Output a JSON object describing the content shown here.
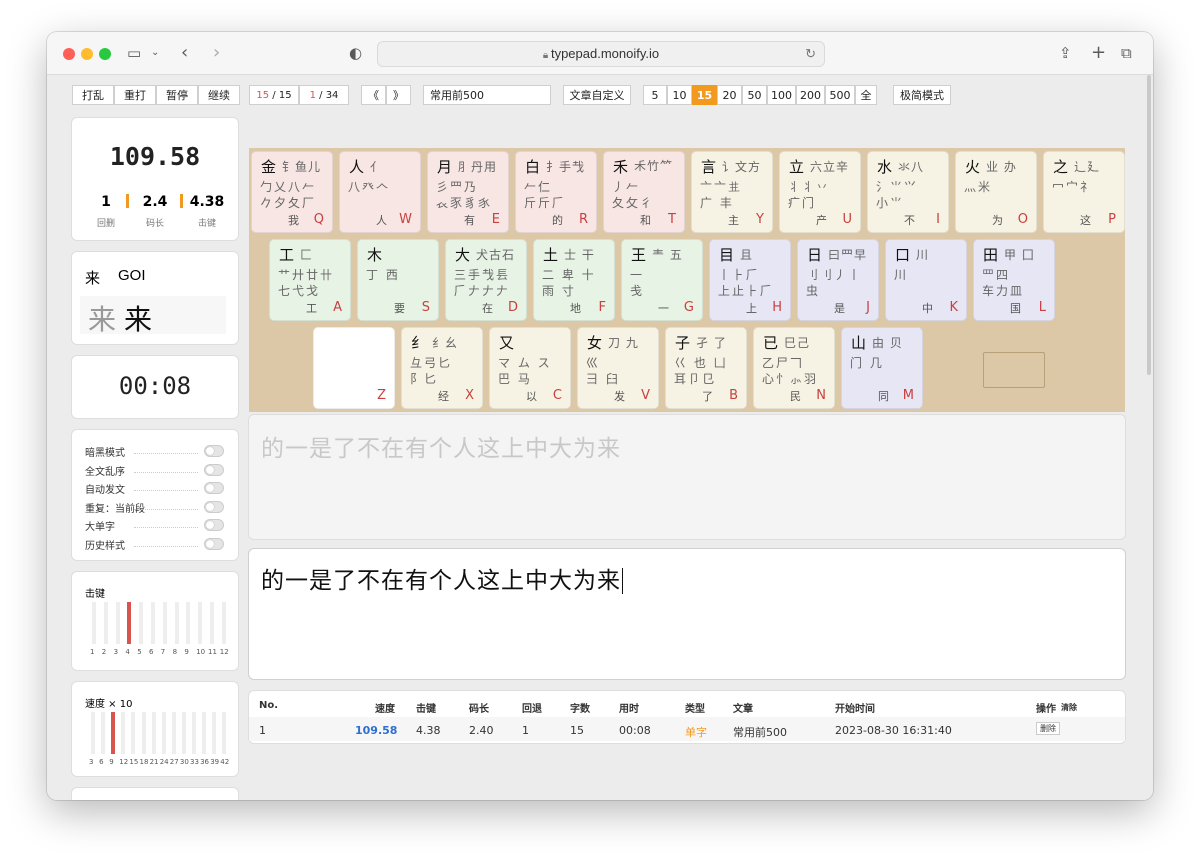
{
  "browser": {
    "url": "typepad.monoify.io"
  },
  "toolbar": {
    "shuffle": "打乱",
    "retype": "重打",
    "pause": "暂停",
    "resume": "继续",
    "para_current": "15",
    "para_total": "15",
    "page_current": "1",
    "page_total": "34",
    "prev": "《",
    "next": "》",
    "article": "常用前500",
    "custom": "文章自定义",
    "counts": [
      "5",
      "10",
      "15",
      "20",
      "50",
      "100",
      "200",
      "500",
      "全"
    ],
    "active_count": "15",
    "mode": "极简模式"
  },
  "stats": {
    "speed": "109.58",
    "backspace": "1",
    "code_len": "2.4",
    "keystroke": "4.38",
    "backspace_label": "回删",
    "code_len_label": "码长",
    "keystroke_label": "击键"
  },
  "hint": {
    "char": "来",
    "code": "GOI",
    "glyph1": "来",
    "glyph2": "来"
  },
  "timer": "00:08",
  "options": [
    "暗黑模式",
    "全文乱序",
    "自动发文",
    "重复：当前段",
    "大单字",
    "历史样式"
  ],
  "keystroke_chart": {
    "title": "击键",
    "labels": [
      "1",
      "2",
      "3",
      "4",
      "5",
      "6",
      "7",
      "8",
      "9",
      "10",
      "11",
      "12"
    ],
    "highlight": 3
  },
  "speed_chart": {
    "title": "速度 × 10",
    "labels": [
      "3",
      "6",
      "9",
      "12",
      "15",
      "18",
      "21",
      "24",
      "27",
      "30",
      "33",
      "36",
      "39",
      "42"
    ],
    "highlight": 2
  },
  "keyboard": {
    "row1": [
      {
        "main": "金",
        "rest": "钅鱼儿",
        "l2": "勹乂八𠂉",
        "l3": "𠂊夕夂厂",
        "ch": "我",
        "key": "Q",
        "bg": "#f7e6e4"
      },
      {
        "main": "人",
        "rest": "亻",
        "l2": "八癶𠆢",
        "l3": "",
        "ch": "人",
        "key": "W",
        "bg": "#f7e6e4"
      },
      {
        "main": "月",
        "rest": "⺼丹用",
        "l2": "彡⺫乃",
        "l3": "𧘇豕豸𧰨",
        "ch": "有",
        "key": "E",
        "bg": "#f7e6e4"
      },
      {
        "main": "白",
        "rest": "扌手𢦏",
        "l2": "𠂉仁",
        "l3": "斤斤𠂆",
        "ch": "的",
        "key": "R",
        "bg": "#f7e6e4"
      },
      {
        "main": "禾",
        "rest": "𥝌竹⺮",
        "l2": "丿𠂉",
        "l3": "夂攵彳",
        "ch": "和",
        "key": "T",
        "bg": "#f7e6e4"
      },
      {
        "main": "言",
        "rest": "讠文方",
        "l2": "亠亠𠀎",
        "l3": "广 丰",
        "ch": "主",
        "key": "Y",
        "bg": "#f6f3e4"
      },
      {
        "main": "立",
        "rest": "六立辛",
        "l2": "丬丬丷",
        "l3": "疒门",
        "ch": "产",
        "key": "U",
        "bg": "#f6f3e4"
      },
      {
        "main": "水",
        "rest": "氺八",
        "l2": "氵⺌⺍",
        "l3": "小⺌",
        "ch": "不",
        "key": "I",
        "bg": "#f6f3e4"
      },
      {
        "main": "火",
        "rest": "业 办",
        "l2": "灬米",
        "l3": "",
        "ch": "为",
        "key": "O",
        "bg": "#f6f3e4"
      },
      {
        "main": "之",
        "rest": "辶廴",
        "l2": "冖宀礻",
        "l3": "",
        "ch": "这",
        "key": "P",
        "bg": "#f6f3e4"
      }
    ],
    "row2": [
      {
        "main": "工",
        "rest": "匚",
        "l2": "艹廾廿卄",
        "l3": "七弋戈",
        "ch": "工",
        "key": "A",
        "bg": "#e7f3e4"
      },
      {
        "main": "木",
        "rest": "",
        "l2": "丁 西",
        "l3": "",
        "ch": "要",
        "key": "S",
        "bg": "#e7f3e4"
      },
      {
        "main": "大",
        "rest": "犬古石",
        "l2": "三手𢦏镸",
        "l3": "𠂆𠂇𠂇𠂇",
        "ch": "在",
        "key": "D",
        "bg": "#e7f3e4"
      },
      {
        "main": "土",
        "rest": "士 干",
        "l2": "二 卑 十",
        "l3": "雨 寸",
        "ch": "地",
        "key": "F",
        "bg": "#e7f3e4"
      },
      {
        "main": "王",
        "rest": "龶 五",
        "l2": "一",
        "l3": "戋",
        "ch": "一",
        "key": "G",
        "bg": "#e7f3e4"
      },
      {
        "main": "目",
        "rest": "且",
        "l2": "丨⺊𠂆",
        "l3": "上止⺊𠂆",
        "ch": "上",
        "key": "H",
        "bg": "#e6e6f5"
      },
      {
        "main": "日",
        "rest": "曰⺫早",
        "l2": "刂刂丿丨",
        "l3": "虫",
        "ch": "是",
        "key": "J",
        "bg": "#e6e6f5"
      },
      {
        "main": "口",
        "rest": "川",
        "l2": "川",
        "l3": "",
        "ch": "中",
        "key": "K",
        "bg": "#e6e6f5"
      },
      {
        "main": "田",
        "rest": "甲 囗",
        "l2": "罒四",
        "l3": "车力皿",
        "ch": "国",
        "key": "L",
        "bg": "#e6e6f5"
      }
    ],
    "row3": [
      {
        "main": "",
        "rest": "",
        "l2": "",
        "l3": "",
        "ch": "",
        "key": "Z",
        "bg": "#ffffff"
      },
      {
        "main": "纟",
        "rest": "纟幺",
        "l2": "彑弓匕",
        "l3": "阝匕",
        "ch": "经",
        "key": "X",
        "bg": "#f6f3e4"
      },
      {
        "main": "又",
        "rest": "",
        "l2": "マ ム ス",
        "l3": "巴 马",
        "ch": "以",
        "key": "C",
        "bg": "#f6f3e4"
      },
      {
        "main": "女",
        "rest": "刀 九",
        "l2": "巛",
        "l3": "彐 臼",
        "ch": "发",
        "key": "V",
        "bg": "#f6f3e4"
      },
      {
        "main": "子",
        "rest": "孑 了",
        "l2": "巜 也 凵",
        "l3": "耳卩㔾",
        "ch": "了",
        "key": "B",
        "bg": "#f6f3e4"
      },
      {
        "main": "已",
        "rest": "巳己",
        "l2": "乙尸𠃍",
        "l3": "心忄⺗羽",
        "ch": "民",
        "key": "N",
        "bg": "#f6f3e4"
      },
      {
        "main": "山",
        "rest": "由 贝",
        "l2": "门 几",
        "l3": "",
        "ch": "同",
        "key": "M",
        "bg": "#e6e6f5"
      }
    ]
  },
  "prompt_text": "的一是了不在有个人这上中大为来",
  "typed_text": "的一是了不在有个人这上中大为来",
  "table": {
    "headers": [
      "No.",
      "速度",
      "击键",
      "码长",
      "回退",
      "字数",
      "用时",
      "类型",
      "文章",
      "开始时间",
      "操作",
      "清除"
    ],
    "row": {
      "no": "1",
      "speed": "109.58",
      "keystroke": "4.38",
      "code_len": "2.40",
      "backspace": "1",
      "chars": "15",
      "time": "00:08",
      "type": "单字",
      "article": "常用前500",
      "start": "2023-08-30 16:31:40",
      "op": "删除"
    }
  },
  "colors": {
    "speed_blue": "#2f6fd0",
    "accent_orange": "#f29a1f",
    "red": "#d9534f"
  }
}
